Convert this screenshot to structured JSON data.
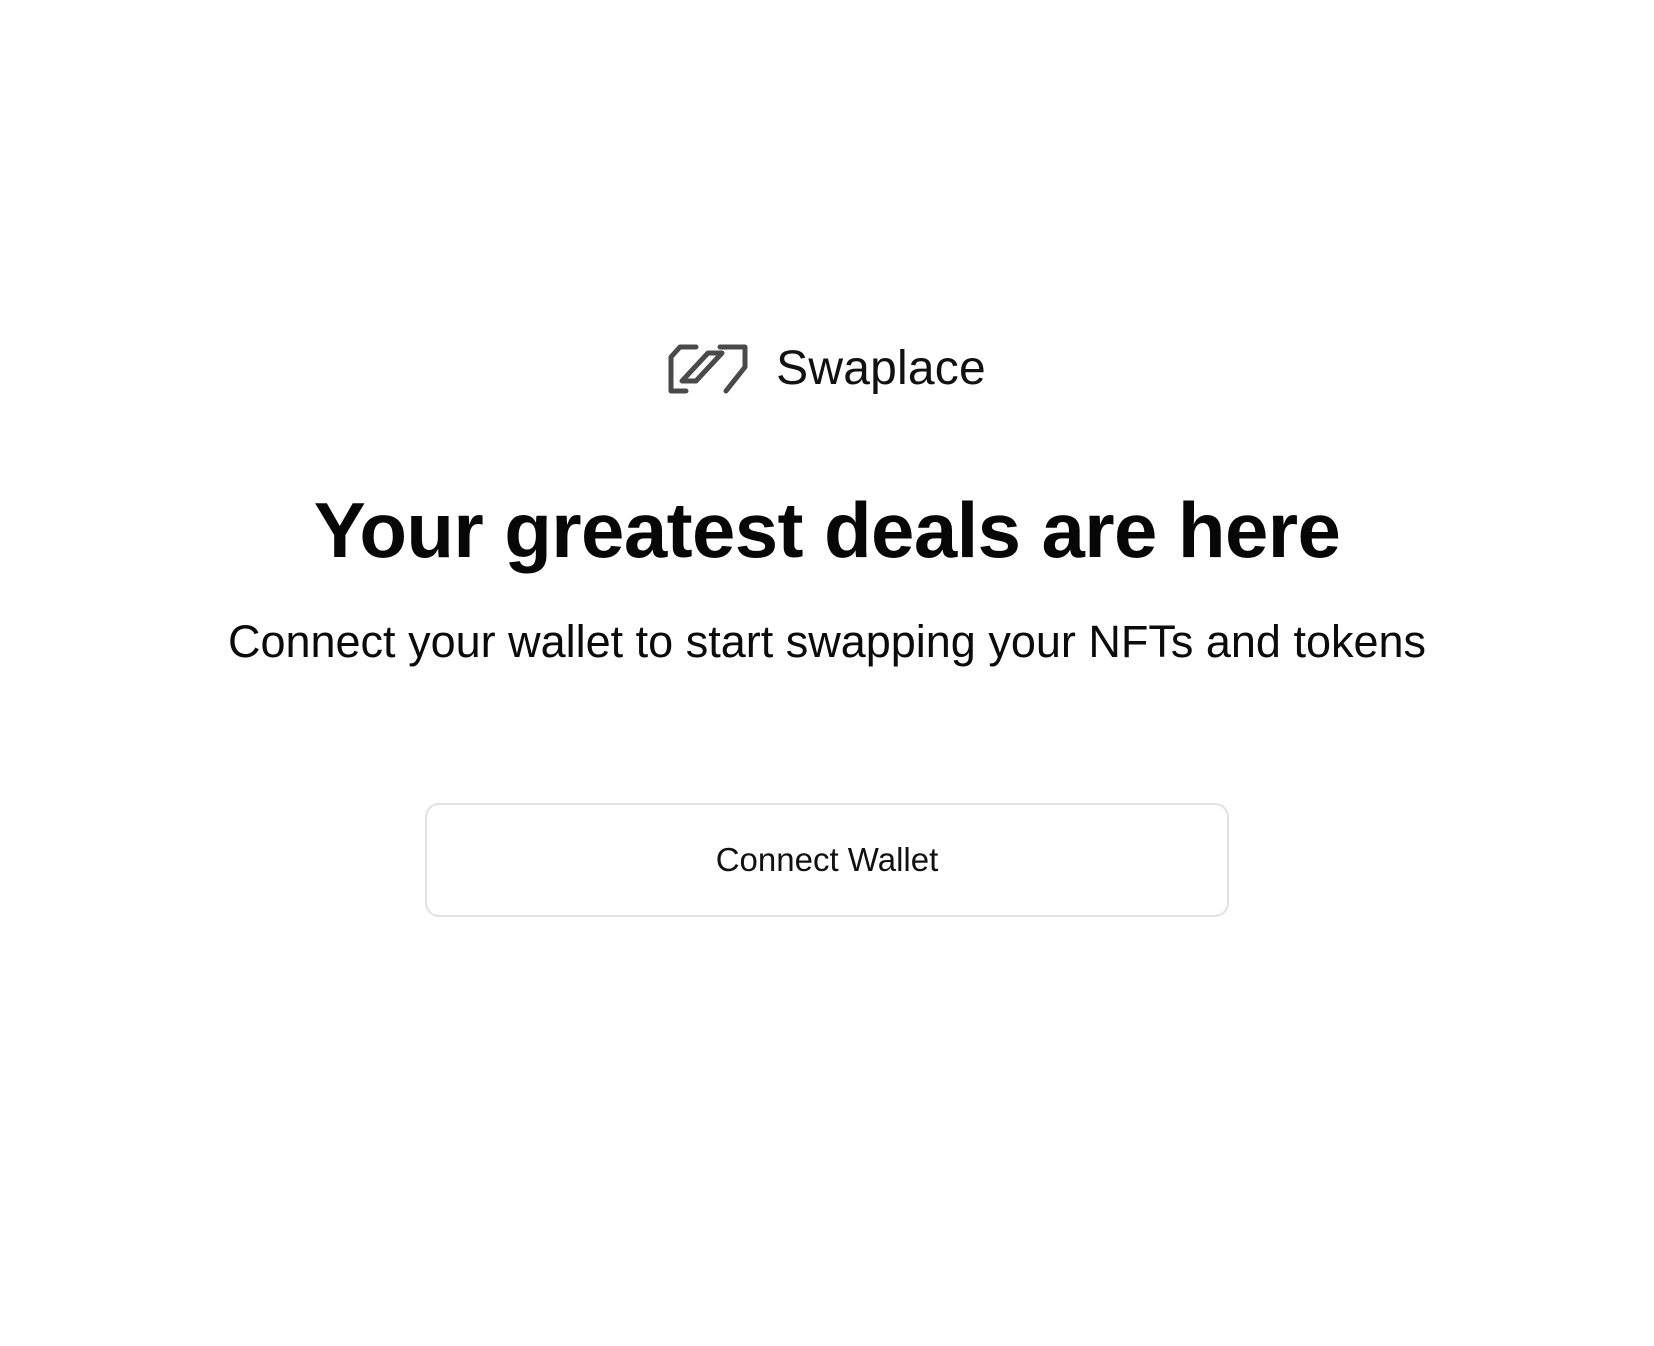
{
  "brand": {
    "logo_icon": "swaplace-logo-icon",
    "name": "Swaplace"
  },
  "hero": {
    "headline": "Your greatest deals are here",
    "subheadline": "Connect your wallet to start swapping your NFTs and tokens"
  },
  "actions": {
    "connect_wallet_label": "Connect Wallet"
  },
  "colors": {
    "background": "#ffffff",
    "text": "#0b0b0b",
    "logo": "#4a4a4a",
    "button_border": "#e2e2e2"
  }
}
